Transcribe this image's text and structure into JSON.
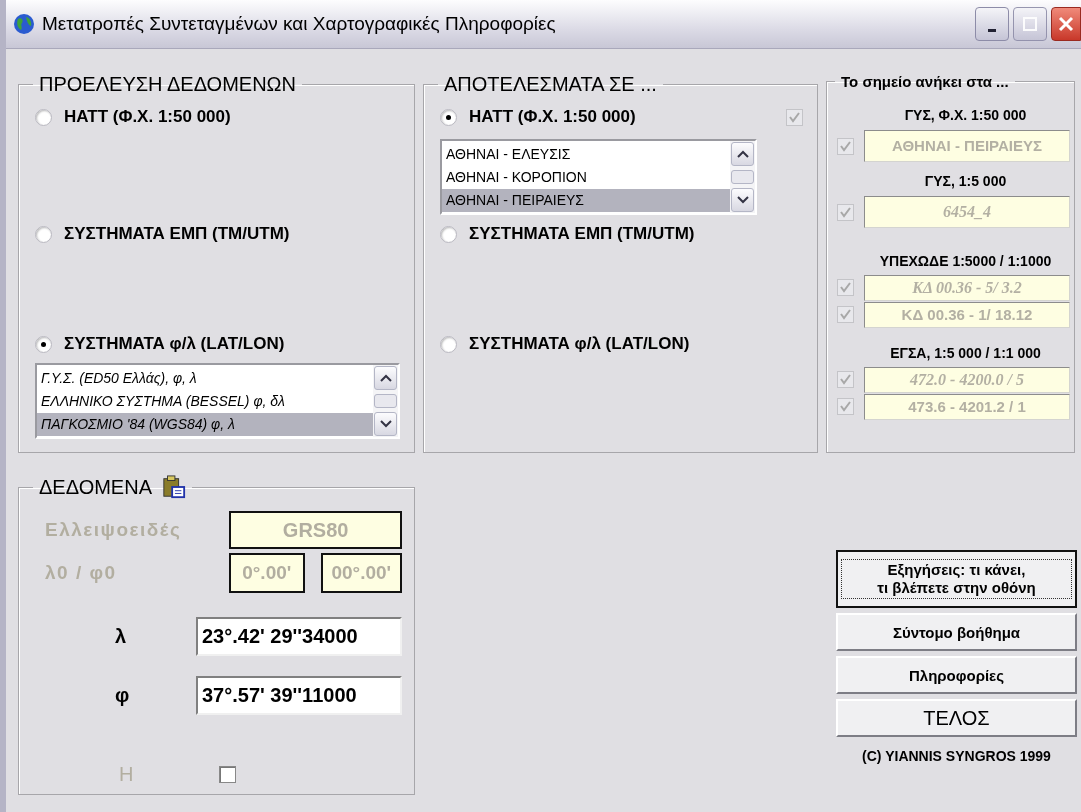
{
  "window": {
    "title": "Μετατροπές Συντεταγμένων και Χαρτογραφικές Πληροφορίες"
  },
  "source": {
    "title": "ΠΡΟΕΛΕΥΣΗ ΔΕΔΟΜΕΝΩΝ",
    "options": [
      {
        "label": "HATT (Φ.Χ. 1:50 000)",
        "selected": false
      },
      {
        "label": "ΣΥΣΤΗΜΑΤΑ ΕΜΠ (TM/UTM)",
        "selected": false
      },
      {
        "label": "ΣΥΣΤΗΜΑΤΑ φ/λ (LAT/LON)",
        "selected": true,
        "list": [
          {
            "label": "Γ.Υ.Σ. (ED50 Ελλάς), φ, λ",
            "selected": false
          },
          {
            "label": "ΕΛΛΗΝΙΚΟ ΣΥΣΤΗΜΑ (BESSEL) φ, δλ",
            "selected": false
          },
          {
            "label": "ΠΑΓΚΟΣΜΙΟ '84 (WGS84) φ, λ",
            "selected": true
          }
        ]
      }
    ]
  },
  "results": {
    "title": "ΑΠΟΤΕΛΕΣΜΑΤΑ ΣΕ ...",
    "options": [
      {
        "label": "HATT (Φ.Χ. 1:50 000)",
        "selected": true,
        "checked": true,
        "list": [
          {
            "label": "ΑΘΗΝΑΙ - ΕΛΕΥΣΙΣ",
            "selected": false
          },
          {
            "label": "ΑΘΗΝΑΙ - ΚΟΡΟΠΙΟΝ",
            "selected": false
          },
          {
            "label": "ΑΘΗΝΑΙ - ΠΕΙΡΑΙΕΥΣ",
            "selected": true
          }
        ]
      },
      {
        "label": "ΣΥΣΤΗΜΑΤΑ ΕΜΠ (TM/UTM)",
        "selected": false
      },
      {
        "label": "ΣΥΣΤΗΜΑΤΑ φ/λ (LAT/LON)",
        "selected": false
      }
    ]
  },
  "belongs": {
    "title": "Το σημείο ανήκει στα ...",
    "groups": [
      {
        "heading": "ΓΥΣ, Φ.Χ. 1:50 000",
        "entries": [
          {
            "checked": true,
            "value": "ΑΘΗΝΑΙ - ΠΕΙΡΑΙΕΥΣ",
            "italic": false
          }
        ]
      },
      {
        "heading": "ΓΥΣ,  1:5 000",
        "entries": [
          {
            "checked": true,
            "value": "6454_4",
            "italic": true
          }
        ]
      },
      {
        "heading": "ΥΠΕΧΩΔΕ 1:5000 / 1:1000",
        "entries": [
          {
            "checked": true,
            "value": "ΚΔ 00.36 - 5/ 3.2",
            "italic": true
          },
          {
            "checked": true,
            "value": "ΚΔ 00.36 - 1/ 18.12",
            "italic": false
          }
        ]
      },
      {
        "heading": "ΕΓΣΑ, 1:5 000 / 1:1 000",
        "entries": [
          {
            "checked": true,
            "value": "472.0 - 4200.0 / 5",
            "italic": true
          },
          {
            "checked": true,
            "value": "473.6 - 4201.2 / 1",
            "italic": false
          }
        ]
      }
    ]
  },
  "data": {
    "title": "ΔΕΔΟΜΕΝΑ",
    "ellipsoid": {
      "label": "Ελλειψοειδές",
      "value": "GRS80"
    },
    "origin": {
      "label": "λ0 / φ0",
      "values": [
        "0°.00'",
        "00°.00'"
      ]
    },
    "coords": [
      {
        "label": "λ",
        "value": "23°.42' 29''34000"
      },
      {
        "label": "φ",
        "value": "37°.57' 39''11000"
      }
    ],
    "height": {
      "label": "H",
      "checked": false
    }
  },
  "buttons": [
    {
      "label": "Εξηγήσεις: τι κάνει,\n τι βλέπετε στην οθόνη",
      "focused": true
    },
    {
      "label": "Σύντομο βοήθημα",
      "focused": false
    },
    {
      "label": "Πληροφορίες",
      "focused": false
    },
    {
      "label": "ΤΕΛΟΣ",
      "focused": false
    }
  ],
  "copyright": "(C) YIANNIS SYNGROS 1999"
}
